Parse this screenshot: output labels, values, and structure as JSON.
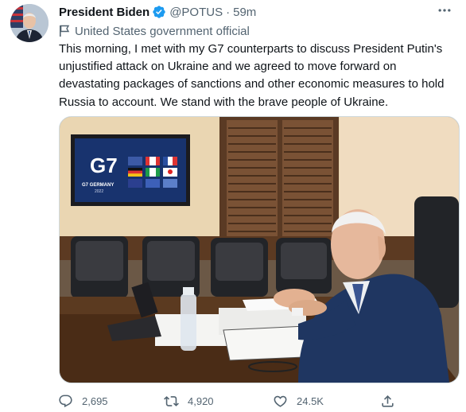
{
  "tweet": {
    "author_name": "President Biden",
    "handle": "@POTUS",
    "separator": "·",
    "time": "59m",
    "account_label": "United States government official",
    "text": "This morning, I met with my G7 counterparts to discuss President Putin's unjustified attack on Ukraine and we agreed to move forward on devastating packages of sanctions and other economic measures to hold Russia to account. We stand with the brave people of Ukraine.",
    "more_icon": "more-dots-icon"
  },
  "media": {
    "screen_logo": "G7",
    "screen_caption": "G7 GERMANY",
    "screen_year": "2022"
  },
  "stats": {
    "replies": "2,695",
    "retweets": "4,920",
    "likes": "24.5K"
  },
  "colors": {
    "verified": "#1d9bf0",
    "secondary_text": "#536471",
    "primary_text": "#0f1419"
  }
}
